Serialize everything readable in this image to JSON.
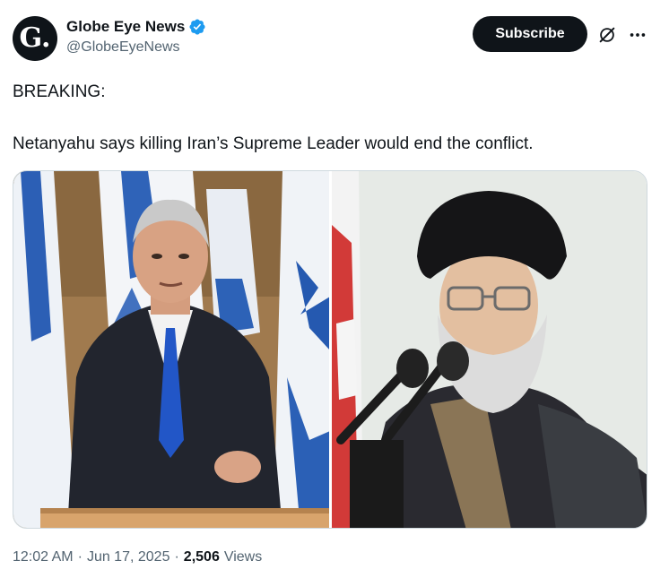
{
  "author": {
    "avatar_letter": "G.",
    "display_name": "Globe Eye News",
    "handle": "@GlobeEyeNews",
    "verified": true
  },
  "actions": {
    "subscribe_label": "Subscribe"
  },
  "post": {
    "line1": "BREAKING:",
    "line2": "Netanyahu says killing Iran’s Supreme Leader would end the conflict."
  },
  "media": {
    "left_image": "photo-netanyahu-at-podium-israeli-flags",
    "right_image": "photo-khamenei-at-microphones-iranian-flag"
  },
  "meta": {
    "time": "12:02 AM",
    "sep1": "·",
    "date": "Jun 17, 2025",
    "sep2": "·",
    "views_count": "2,506",
    "views_label": "Views"
  },
  "colors": {
    "text_primary": "#0f1419",
    "text_secondary": "#536471",
    "verified_blue": "#1d9bf0",
    "border": "#cfd9de"
  }
}
